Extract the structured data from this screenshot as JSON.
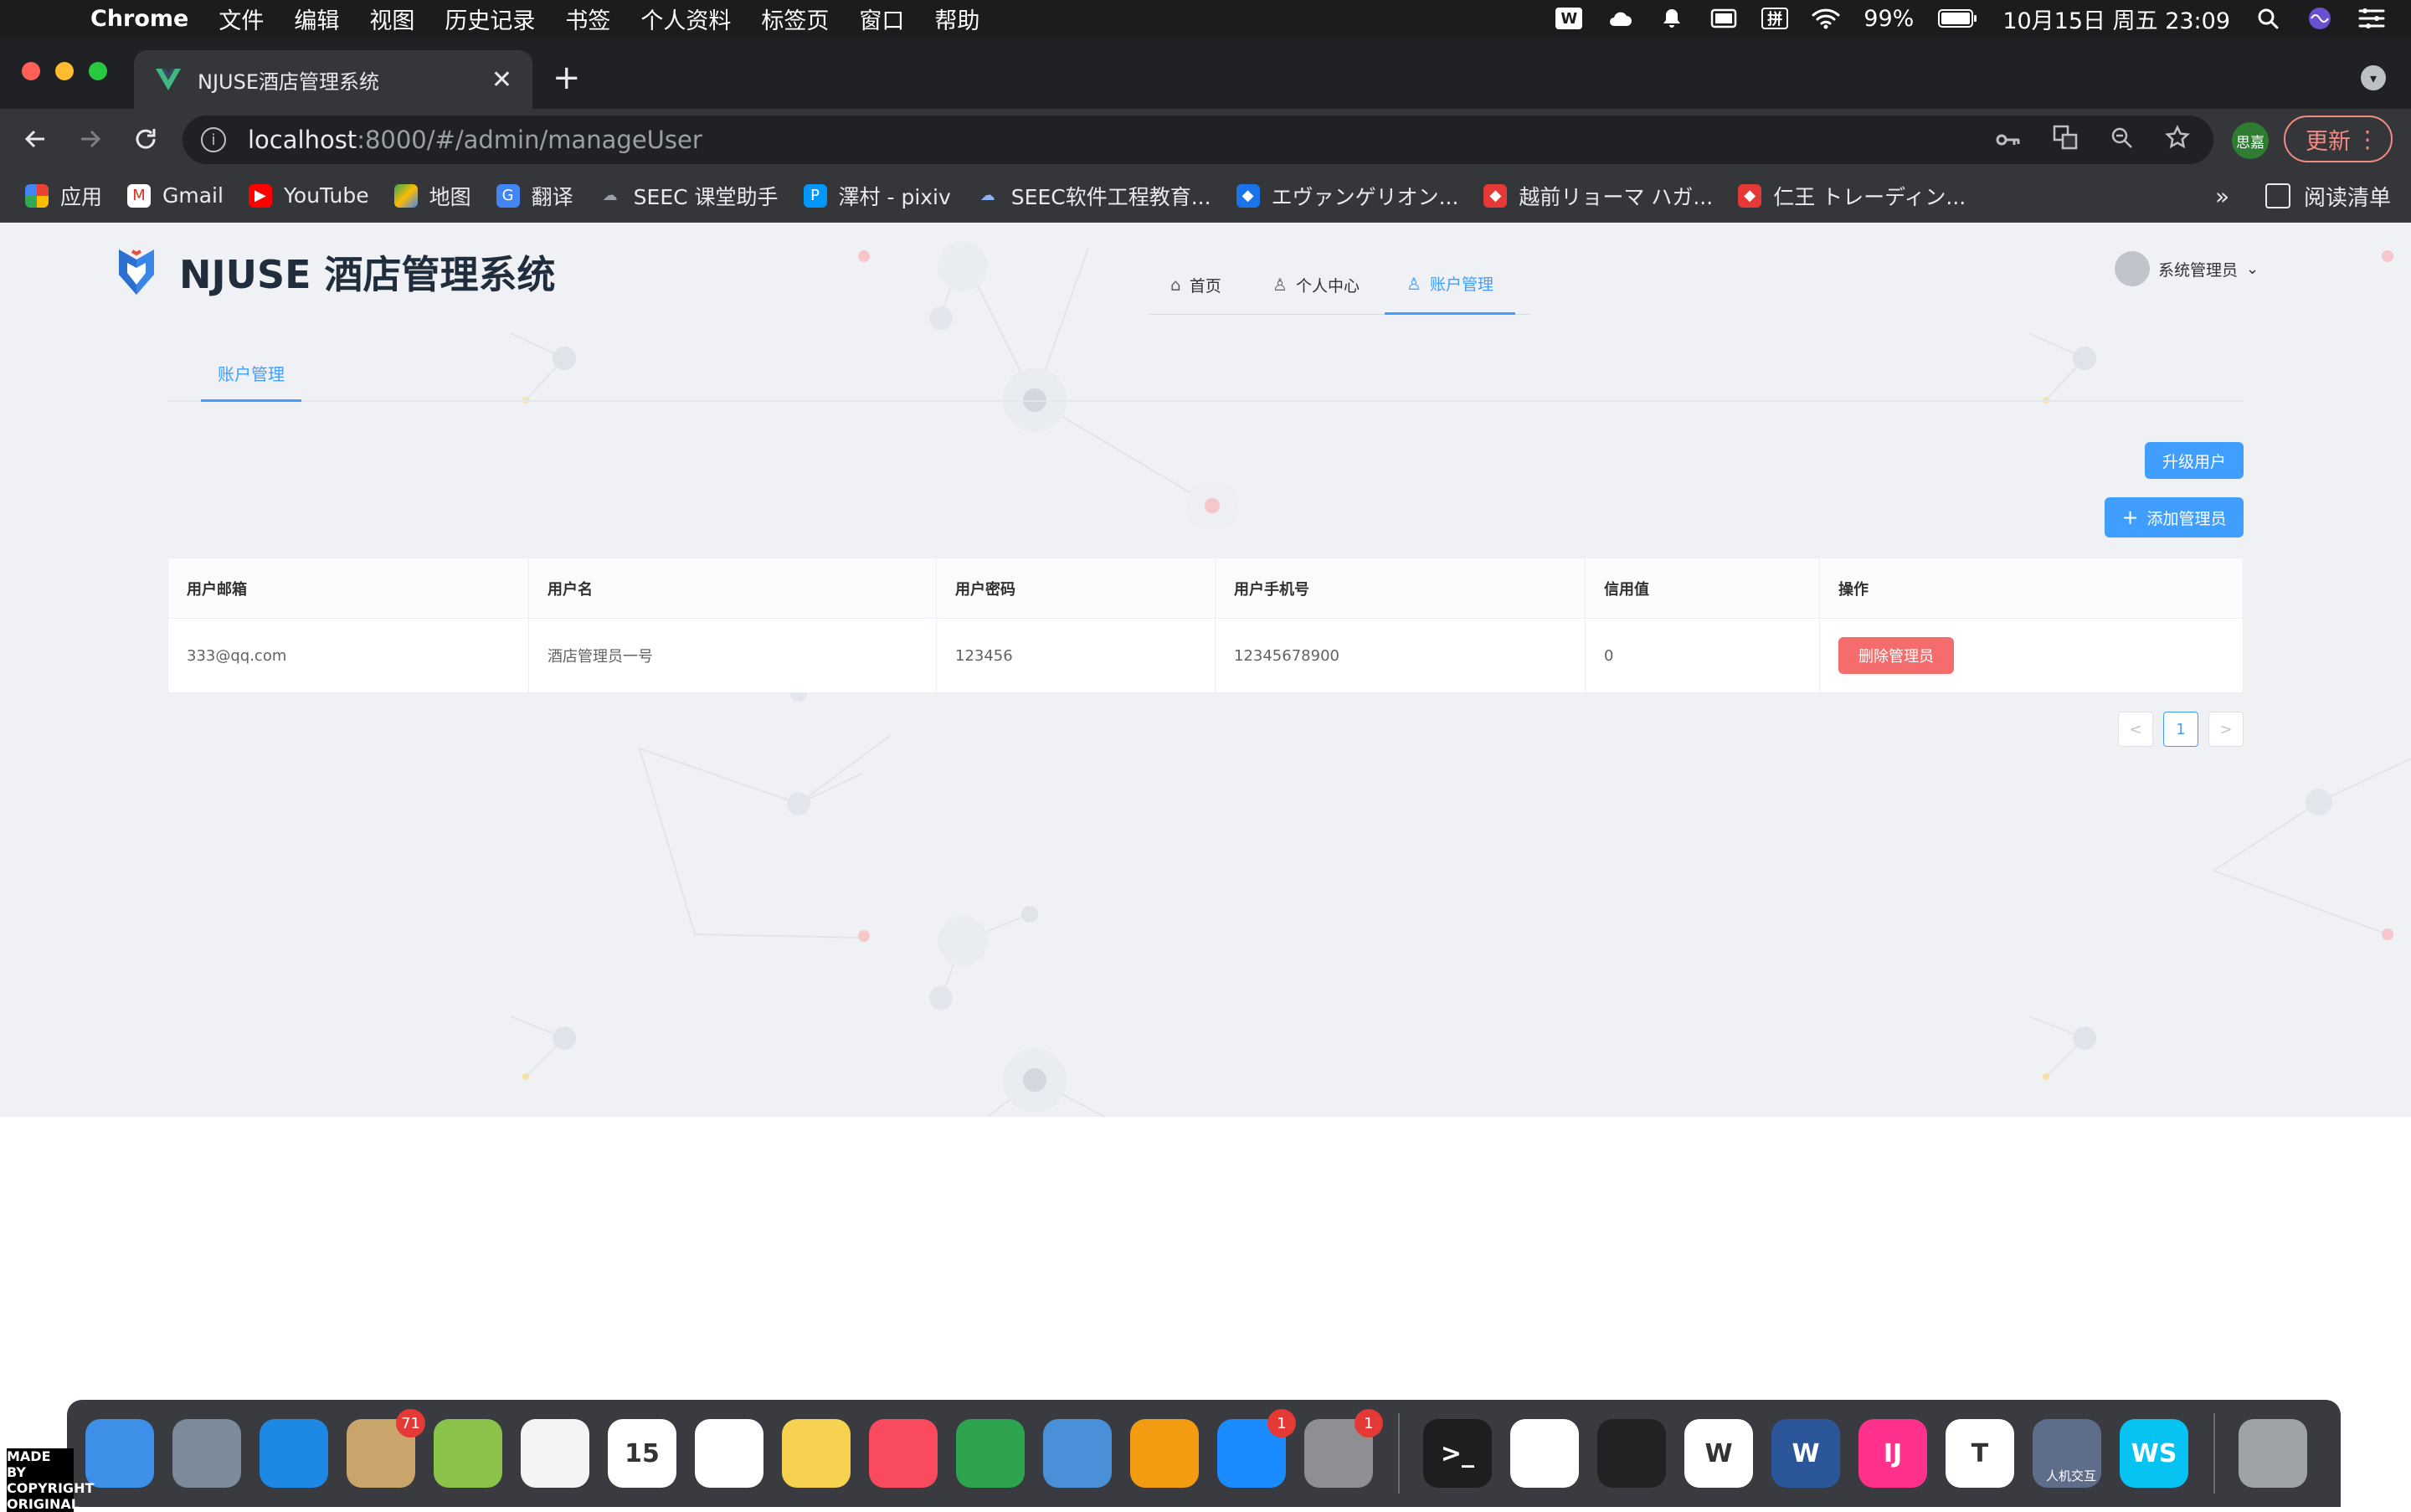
{
  "menubar": {
    "app_name": "Chrome",
    "menus": [
      "文件",
      "编辑",
      "视图",
      "历史记录",
      "书签",
      "个人资料",
      "标签页",
      "窗口",
      "帮助"
    ],
    "battery": "99%",
    "datetime": "10月15日 周五  23:09",
    "tray_icons": [
      "wps-tray-icon",
      "cloud-tray-icon",
      "notification-icon",
      "display-icon",
      "pinyin-ime-icon",
      "wifi-icon",
      "battery-icon",
      "spotlight-icon",
      "siri-icon",
      "control-center-icon"
    ],
    "pinyin_label": "拼",
    "wps_label": "W"
  },
  "browser": {
    "tab_title": "NJUSE酒店管理系统",
    "url_host": "localhost",
    "url_path": ":8000/#/admin/manageUser",
    "profile_label": "思嘉",
    "update_label": "更新",
    "bookmarks": [
      {
        "label": "应用",
        "icon": "apps-grid-icon",
        "color": "#ea4335"
      },
      {
        "label": "Gmail",
        "icon": "gmail-icon",
        "color": "#d93025"
      },
      {
        "label": "YouTube",
        "icon": "youtube-icon",
        "color": "#ff0000"
      },
      {
        "label": "地图",
        "icon": "maps-icon",
        "color": "#34a853"
      },
      {
        "label": "翻译",
        "icon": "translate-icon",
        "color": "#4285f4"
      },
      {
        "label": "SEEC 课堂助手",
        "icon": "cloud-icon",
        "color": "#5f6368"
      },
      {
        "label": "澤村 - pixiv",
        "icon": "pixiv-icon",
        "color": "#0096fa"
      },
      {
        "label": "SEEC软件工程教育...",
        "icon": "cloud-icon",
        "color": "#8ab4f8"
      },
      {
        "label": "エヴァンゲリオン...",
        "icon": "bookmark-icon",
        "color": "#1a73e8"
      },
      {
        "label": "越前リョーマ ハガ...",
        "icon": "bookmark-icon",
        "color": "#e53935"
      },
      {
        "label": "仁王 トレーディン...",
        "icon": "bookmark-icon",
        "color": "#e53935"
      }
    ],
    "more_label": "»",
    "reading_list_label": "阅读清单"
  },
  "app": {
    "title": "NJUSE 酒店管理系统",
    "nav": [
      {
        "label": "首页",
        "icon": "home-icon"
      },
      {
        "label": "个人中心",
        "icon": "user-icon"
      },
      {
        "label": "账户管理",
        "icon": "user-icon"
      }
    ],
    "active_nav": "账户管理",
    "user_name": "系统管理员",
    "sub_tab": "账户管理",
    "upgrade_button": "升级用户",
    "add_admin_button": "添加管理员",
    "add_icon": "+",
    "table": {
      "columns": [
        "用户邮箱",
        "用户名",
        "用户密码",
        "用户手机号",
        "信用值",
        "操作"
      ],
      "rows": [
        {
          "email": "333@qq.com",
          "username": "酒店管理员一号",
          "password": "123456",
          "phone": "12345678900",
          "credit": "0",
          "action": "删除管理员"
        }
      ]
    },
    "pagination": {
      "prev": "<",
      "page": "1",
      "next": ">"
    }
  },
  "dock": {
    "apps": [
      {
        "name": "Finder",
        "color": "#3d8fe8"
      },
      {
        "name": "Launchpad",
        "color": "#7d8a9a"
      },
      {
        "name": "Safari",
        "color": "#1e88e5"
      },
      {
        "name": "Mail",
        "color": "#c9a46b",
        "badge": "71"
      },
      {
        "name": "Maps",
        "color": "#8bc34a"
      },
      {
        "name": "Photos",
        "color": "#f4f4f4"
      },
      {
        "name": "Calendar",
        "color": "#ffffff",
        "label": "15"
      },
      {
        "name": "Reminders",
        "color": "#ffffff"
      },
      {
        "name": "Notes",
        "color": "#f7d251"
      },
      {
        "name": "Music",
        "color": "#fa4a5e"
      },
      {
        "name": "Numbers",
        "color": "#2ea44f"
      },
      {
        "name": "Keynote",
        "color": "#4a90d9"
      },
      {
        "name": "Pages",
        "color": "#f39c12"
      },
      {
        "name": "App Store",
        "color": "#1a8cff",
        "badge": "1"
      },
      {
        "name": "System Preferences",
        "color": "#8e8e93",
        "badge": "1"
      },
      {
        "name": "Terminal",
        "color": "#1e1e1e",
        "label": ">_"
      },
      {
        "name": "Chrome",
        "color": "#ffffff"
      },
      {
        "name": "QQ",
        "color": "#222222"
      },
      {
        "name": "WPS",
        "color": "#ffffff",
        "label": "W"
      },
      {
        "name": "Word",
        "color": "#2b579a",
        "label": "W"
      },
      {
        "name": "IntelliJ IDEA",
        "color": "#ff318c",
        "label": "IJ"
      },
      {
        "name": "Typora",
        "color": "#ffffff",
        "label": "T"
      },
      {
        "name": "人机交互",
        "color": "#5d6d8a"
      },
      {
        "name": "WebStorm",
        "color": "#07c3f2",
        "label": "WS"
      },
      {
        "name": "Trash",
        "color": "#9ea3a8"
      }
    ],
    "caption": "人机交互"
  },
  "watermark": "MADE BY COPYRIGHT ORIGINAL",
  "colors": {
    "primary": "#409eff",
    "danger": "#f56c6c",
    "page_bg": "#eff1f5"
  }
}
